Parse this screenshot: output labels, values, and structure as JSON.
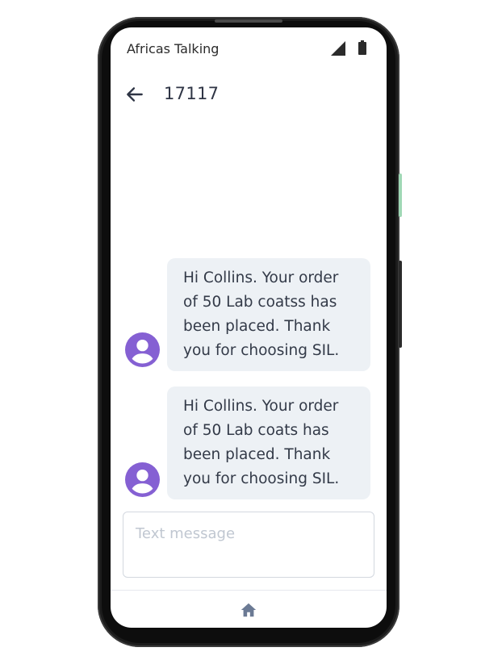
{
  "status_bar": {
    "carrier": "Africas Talking",
    "icons": [
      "signal-icon",
      "battery-icon"
    ]
  },
  "header": {
    "back_icon": "arrow-left-icon",
    "title": "17117"
  },
  "messages": [
    {
      "text": "Hi Collins. Your order\nof 50 Lab coatss has\nbeen placed. Thank\nyou for choosing SIL.",
      "avatar_icon": "account-circle-icon"
    },
    {
      "text": "Hi Collins. Your order\nof 50 Lab coats has\nbeen placed. Thank\nyou for choosing SIL.",
      "avatar_icon": "account-circle-icon"
    }
  ],
  "composer": {
    "placeholder": "Text message",
    "value": ""
  },
  "nav": {
    "home_icon": "home-icon"
  },
  "colors": {
    "avatar": "#8560d3",
    "bubble_bg": "#edf1f5",
    "bubble_text": "#333a48",
    "header_text": "#2f3545",
    "home_icon": "#6b7a94"
  }
}
